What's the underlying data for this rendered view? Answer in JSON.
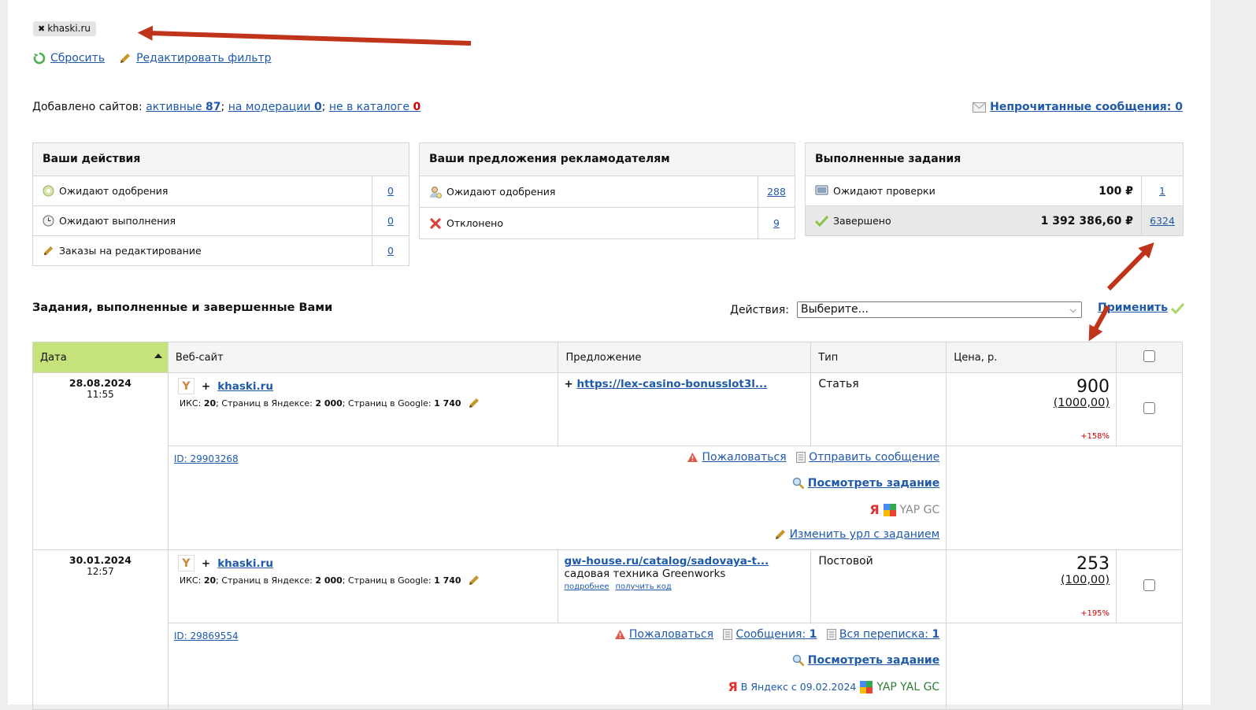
{
  "filter": {
    "chip_label": "khaski.ru",
    "reset_label": "Сбросить",
    "edit_label": "Редактировать фильтр"
  },
  "sites": {
    "prefix": "Добавлено сайтов:",
    "active_label": "активные",
    "active_count": "87",
    "moderation_label": "на модерации",
    "moderation_count": "0",
    "notcatalog_label": "не в каталоге",
    "notcatalog_count": "0"
  },
  "unread": {
    "label": "Непрочитанные сообщения: 0"
  },
  "panels": {
    "actions": {
      "title": "Ваши действия",
      "rows": [
        {
          "label": "Ожидают одобрения",
          "count": "0"
        },
        {
          "label": "Ожидают выполнения",
          "count": "0"
        },
        {
          "label": "Заказы на редактирование",
          "count": "0"
        }
      ]
    },
    "offers": {
      "title": "Ваши предложения рекламодателям",
      "rows": [
        {
          "label": "Ожидают одобрения",
          "count": "288"
        },
        {
          "label": "Отклонено",
          "count": "9"
        }
      ]
    },
    "done": {
      "title": "Выполненные задания",
      "rows": [
        {
          "label": "Ожидают проверки",
          "amount": "100 ₽",
          "count": "1"
        },
        {
          "label": "Завершено",
          "amount": "1 392 386,60 ₽",
          "count": "6324"
        }
      ]
    }
  },
  "section": {
    "title": "Задания, выполненные и завершенные Вами",
    "actions_label": "Действия:",
    "select_value": "Выберите...",
    "apply_label": "Применить"
  },
  "table": {
    "headers": [
      "Дата",
      "Веб-сайт",
      "Предложение",
      "Тип",
      "Цена, р."
    ],
    "rows": [
      {
        "date": "28.08.2024",
        "time": "11:55",
        "site": "khaski.ru",
        "iks_label": "ИКС:",
        "iks": "20",
        "yandex_label": "; Страниц в Яндексе:",
        "yandex": "2 000",
        "google_label": "; Страниц в Google:",
        "google": "1 740",
        "offer_link": "https://lex-casino-bonusslot3l...",
        "type": "Статья",
        "price": "900",
        "old_price": "(1000,00)",
        "pct": "+158%",
        "id": "ID: 29903268",
        "complain": "Пожаловаться",
        "send_msg": "Отправить сообщение",
        "view": "Посмотреть задание",
        "tags": "YAP GC",
        "change_url": "Изменить урл с заданием"
      },
      {
        "date": "30.01.2024",
        "time": "12:57",
        "site": "khaski.ru",
        "iks_label": "ИКС:",
        "iks": "20",
        "yandex_label": "; Страниц в Яндексе:",
        "yandex": "2 000",
        "google_label": "; Страниц в Google:",
        "google": "1 740",
        "offer_link": "gw-house.ru/catalog/sadovaya-t...",
        "offer_text": "садовая техника Greenworks",
        "more": "подробнее",
        "get_code": "получить код",
        "type": "Постовой",
        "price": "253",
        "old_price": "(100,00)",
        "pct": "+195%",
        "id": "ID: 29869554",
        "complain": "Пожаловаться",
        "messages_label": "Сообщения:",
        "messages": "1",
        "all_corr_label": "Вся переписка:",
        "all_corr": "1",
        "view": "Посмотреть задание",
        "indexed": "В Яндекс с 09.02.2024",
        "tags": "YAP YAL GC"
      }
    ]
  },
  "colors": {
    "link": "#1f5aa8",
    "sorted_header": "#c6e27a",
    "arrow": "#c0341b",
    "red_text": "#d10000"
  }
}
